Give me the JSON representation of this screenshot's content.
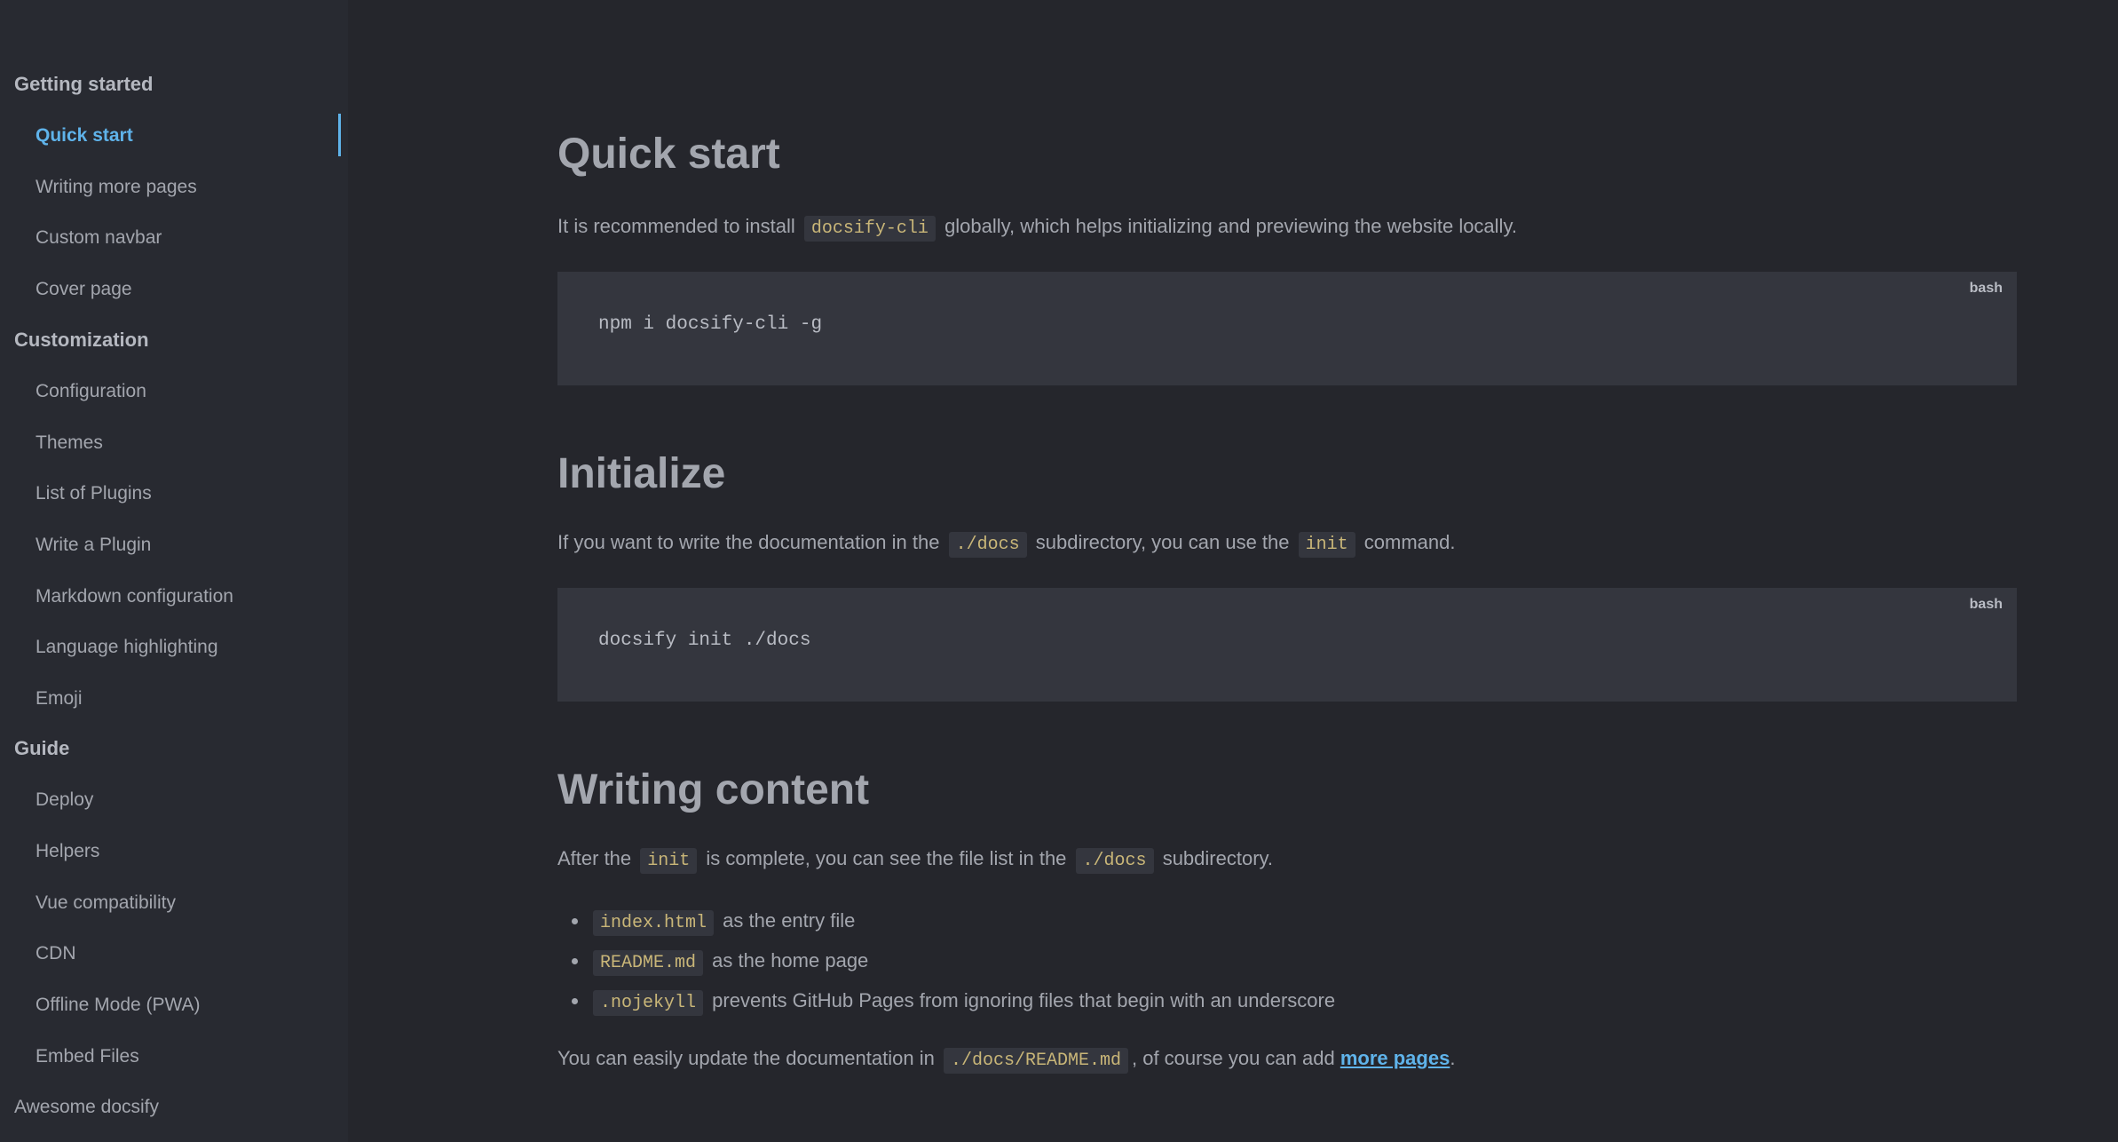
{
  "sidebar": {
    "groups": [
      {
        "label": "Getting started"
      },
      {
        "label": "Customization"
      },
      {
        "label": "Guide"
      }
    ],
    "items": [
      {
        "label": "Quick start"
      },
      {
        "label": "Writing more pages"
      },
      {
        "label": "Custom navbar"
      },
      {
        "label": "Cover page"
      },
      {
        "label": "Configuration"
      },
      {
        "label": "Themes"
      },
      {
        "label": "List of Plugins"
      },
      {
        "label": "Write a Plugin"
      },
      {
        "label": "Markdown configuration"
      },
      {
        "label": "Language highlighting"
      },
      {
        "label": "Emoji"
      },
      {
        "label": "Deploy"
      },
      {
        "label": "Helpers"
      },
      {
        "label": "Vue compatibility"
      },
      {
        "label": "CDN"
      },
      {
        "label": "Offline Mode (PWA)"
      },
      {
        "label": "Embed Files"
      }
    ],
    "footer_link": "Awesome docsify",
    "active_item": "Quick start",
    "accent_color": "#5fb3ea"
  },
  "quick_start": {
    "title": "Quick start",
    "p1_pre": "It is recommended to install",
    "p1_code": "docsify-cli",
    "p1_post": "globally, which helps initializing and previewing the website locally.",
    "code": "npm i docsify-cli -g",
    "code_lang": "bash"
  },
  "initialize": {
    "title": "Initialize",
    "p_pre": "If you want to write the documentation in the",
    "p_code1": "./docs",
    "p_mid": "subdirectory, you can use the",
    "p_code2": "init",
    "p_post": "command.",
    "code": "docsify init ./docs",
    "code_lang": "bash"
  },
  "writing": {
    "title": "Writing content",
    "p_pre": "After the",
    "p_code1": "init",
    "p_mid": "is complete, you can see the file list in the",
    "p_code2": "./docs",
    "p_post": "subdirectory.",
    "bullets": [
      {
        "code": "index.html",
        "text": "as the entry file"
      },
      {
        "code": "README.md",
        "text": "as the home page"
      },
      {
        "code": ".nojekyll",
        "text": "prevents GitHub Pages from ignoring files that begin with an underscore"
      }
    ],
    "final_pre": "You can easily update the documentation in",
    "final_code": "./docs/README.md",
    "final_mid": ", of course you can add",
    "final_link": "more pages",
    "final_post": "."
  }
}
